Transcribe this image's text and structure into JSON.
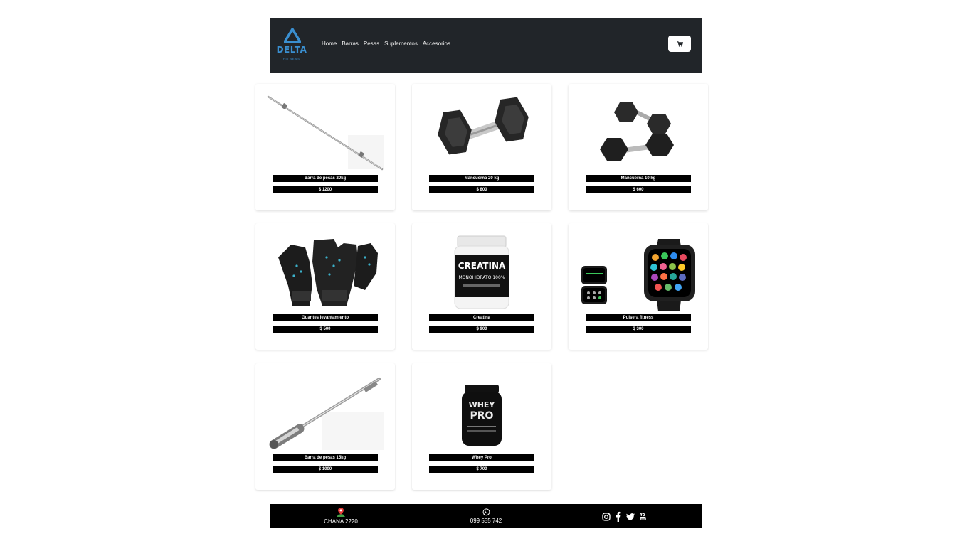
{
  "brand": {
    "name": "DELTA",
    "tagline": "FITNESS",
    "accent_color": "#3a8fd0"
  },
  "nav": {
    "links": [
      "Home",
      "Barras",
      "Pesas",
      "Suplementos",
      "Accesorios"
    ],
    "cart_icon": "cart-icon"
  },
  "products": [
    {
      "name": "Barra de pesas 20kg",
      "price": "$ 1200",
      "image": "straight-barbell"
    },
    {
      "name": "Mancuerna 20 kg",
      "price": "$ 800",
      "image": "hex-dumbbell"
    },
    {
      "name": "Mancuerna 10 kg",
      "price": "$ 600",
      "image": "dumbbell-pair"
    },
    {
      "name": "Guantes levantamiento",
      "price": "$ 500",
      "image": "lifting-gloves"
    },
    {
      "name": "Creatina",
      "price": "$ 900",
      "image": "creatine-tub"
    },
    {
      "name": "Pulsera fitness",
      "price": "$ 300",
      "image": "smartwatch"
    },
    {
      "name": "Barra de pesas 15kg",
      "price": "$ 1000",
      "image": "olympic-barbell"
    },
    {
      "name": "Whey Pro",
      "price": "$ 700",
      "image": "whey-tub"
    }
  ],
  "product_labels": {
    "creatine_label_1": "CREATINA",
    "creatine_label_2": "MONOHIDRATO 100%",
    "whey_label_1": "WHEY",
    "whey_label_2": "PRO"
  },
  "footer": {
    "address": "CHANA 2220",
    "phone": "099 555 742",
    "socials": [
      "instagram-icon",
      "facebook-icon",
      "twitter-icon",
      "youtube-icon"
    ],
    "bg_color": "#000000"
  }
}
